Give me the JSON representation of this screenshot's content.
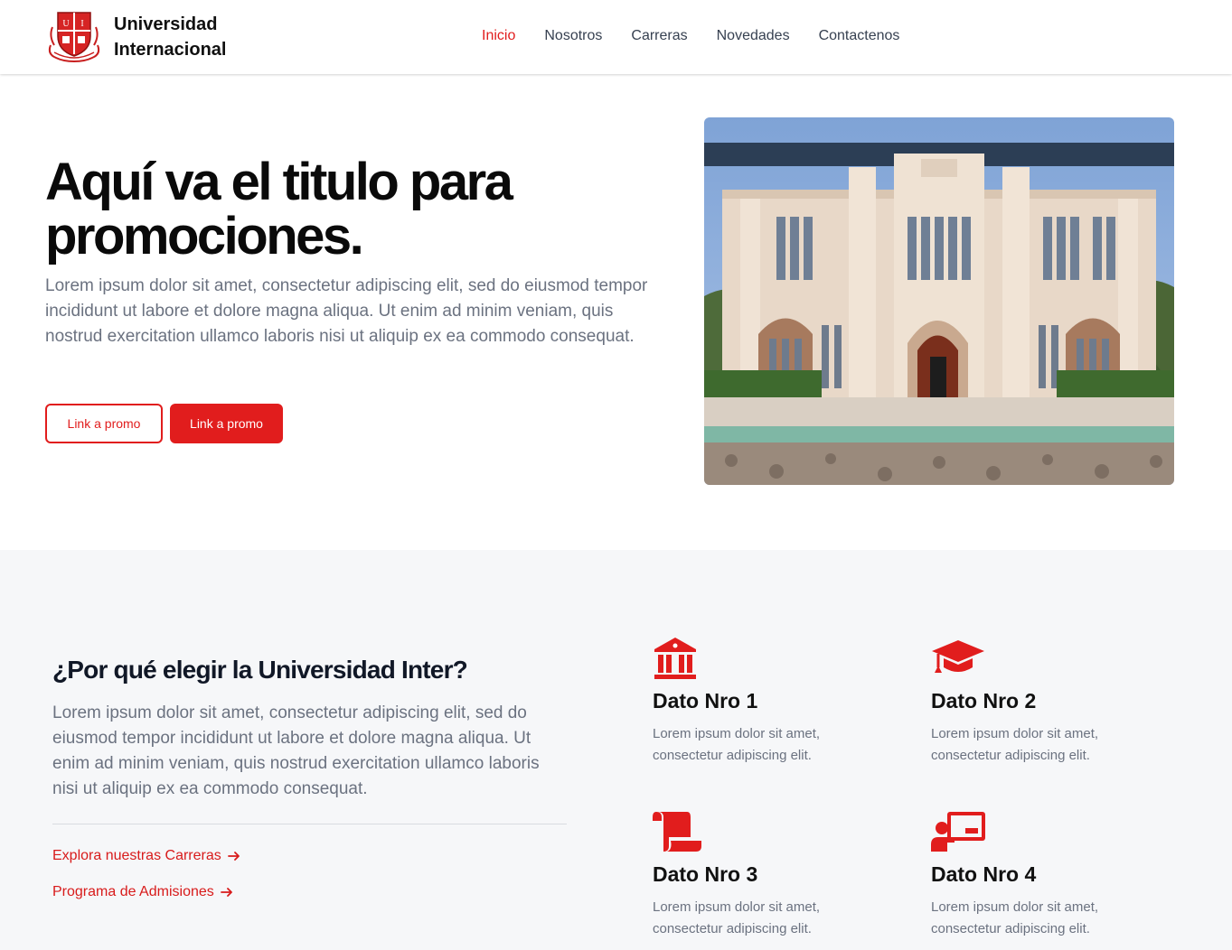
{
  "header": {
    "brand_name": "Universidad Internacional",
    "nav": [
      {
        "label": "Inicio",
        "active": true
      },
      {
        "label": "Nosotros"
      },
      {
        "label": "Carreras"
      },
      {
        "label": "Novedades"
      },
      {
        "label": "Contactenos"
      }
    ]
  },
  "hero": {
    "title": "Aquí va el titulo para promociones.",
    "text": "Lorem ipsum dolor sit amet, consectetur adipiscing elit, sed do eiusmod tempor incididunt ut labore et dolore magna aliqua. Ut enim ad minim veniam, quis nostrud exercitation ullamco laboris nisi ut aliquip ex ea commodo consequat.",
    "button_outline": "Link a promo",
    "button_solid": "Link a promo"
  },
  "why": {
    "title": "¿Por qué elegir la Universidad Inter?",
    "text": "Lorem ipsum dolor sit amet, consectetur adipiscing elit, sed do eiusmod tempor incididunt ut labore et dolore magna aliqua. Ut enim ad minim veniam, quis nostrud exercitation ullamco laboris nisi ut aliquip ex ea commodo consequat.",
    "link1": "Explora nuestras Carreras",
    "link2": "Programa de Admisiones"
  },
  "features": [
    {
      "icon": "university-icon",
      "title": "Dato Nro 1",
      "text": "Lorem ipsum dolor sit amet, consectetur adipiscing elit."
    },
    {
      "icon": "graduation-cap-icon",
      "title": "Dato Nro 2",
      "text": "Lorem ipsum dolor sit amet, consectetur adipiscing elit."
    },
    {
      "icon": "scroll-icon",
      "title": "Dato Nro 3",
      "text": "Lorem ipsum dolor sit amet, consectetur adipiscing elit."
    },
    {
      "icon": "chalkboard-teacher-icon",
      "title": "Dato Nro 4",
      "text": "Lorem ipsum dolor sit amet, consectetur adipiscing elit."
    }
  ],
  "colors": {
    "accent": "#e11d1d",
    "section_bg": "#f6f7f9"
  }
}
